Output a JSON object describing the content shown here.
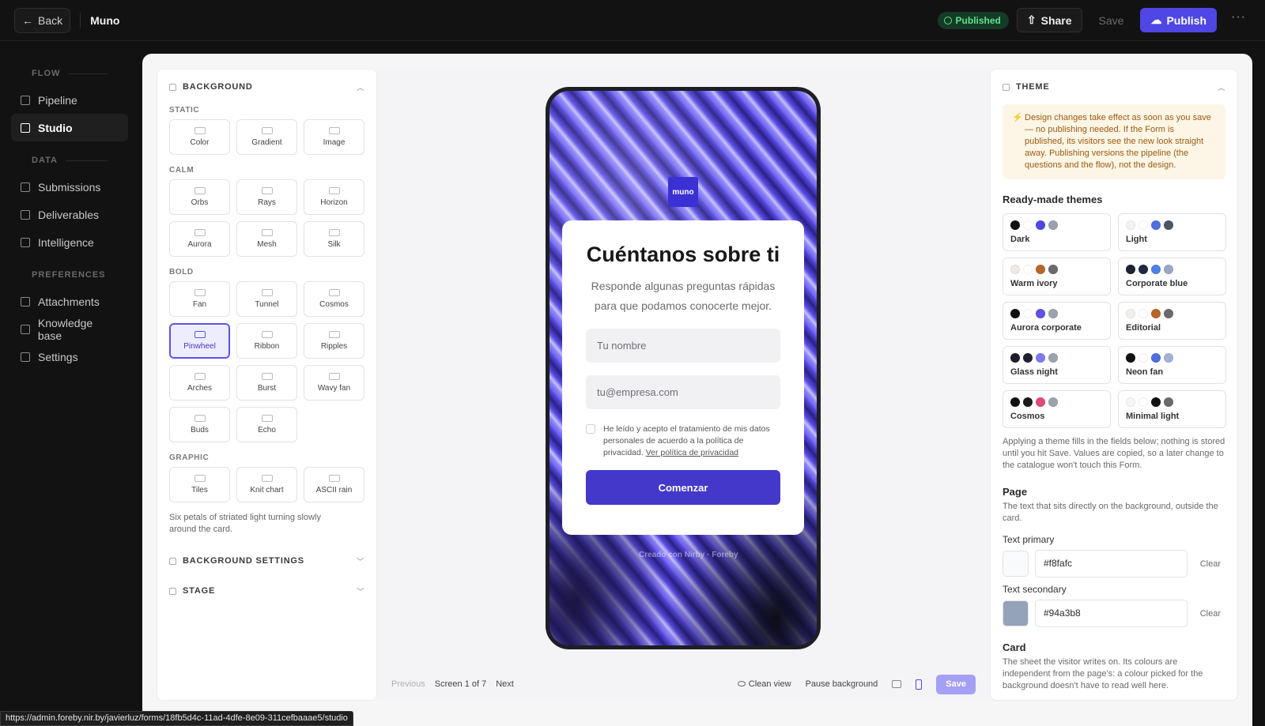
{
  "topbar": {
    "back_label": "Back",
    "title": "Muno",
    "status_badge": "Published",
    "share_label": "Share",
    "save_label": "Save",
    "publish_label": "Publish",
    "more_label": "···"
  },
  "nav": {
    "groups": [
      {
        "label": "FLOW",
        "items": [
          {
            "label": "Pipeline"
          },
          {
            "label": "Studio"
          }
        ]
      },
      {
        "label": "DATA",
        "items": [
          {
            "label": "Submissions"
          },
          {
            "label": "Deliverables"
          },
          {
            "label": "Intelligence"
          }
        ]
      },
      {
        "label": "PREFERENCES",
        "items": [
          {
            "label": "Attachments"
          },
          {
            "label": "Knowledge base"
          },
          {
            "label": "Settings"
          }
        ]
      }
    ],
    "active": "Studio"
  },
  "background_panel": {
    "title": "BACKGROUND",
    "static_label": "STATIC",
    "static": [
      "Color",
      "Gradient",
      "Image"
    ],
    "calm_label": "CALM",
    "calm": [
      "Orbs",
      "Rays",
      "Horizon",
      "Aurora",
      "Mesh",
      "Silk"
    ],
    "bold_label": "BOLD",
    "bold": [
      "Fan",
      "Tunnel",
      "Cosmos",
      "Pinwheel",
      "Ribbon",
      "Ripples",
      "Arches",
      "Burst",
      "Wavy fan",
      "Buds",
      "Echo"
    ],
    "graphic_label": "GRAPHIC",
    "graphic": [
      "Tiles",
      "Knit chart",
      "ASCII rain"
    ],
    "selected": "Pinwheel",
    "description": "Six petals of striated light turning slowly around the card.",
    "settings_label": "BACKGROUND SETTINGS",
    "stage_label": "STAGE"
  },
  "preview": {
    "logo_text": "muno",
    "title": "Cuéntanos sobre ti",
    "lead": "Responde algunas preguntas rápidas para que podamos conocerte mejor.",
    "name_placeholder": "Tu nombre",
    "email_placeholder": "tu@empresa.com",
    "consent_text": "He leído y acepto el tratamiento de mis datos personales de acuerdo a la política de privacidad.",
    "consent_link": "Ver política de privacidad",
    "cta": "Comenzar",
    "powered": "Creado con Nirby · Foreby"
  },
  "canvas_bar": {
    "previous": "Previous",
    "screen_counter": "Screen 1 of 7",
    "next": "Next",
    "clean_view": "Clean view",
    "pause_background": "Pause background",
    "save": "Save"
  },
  "theme_panel": {
    "title": "THEME",
    "note": "Design changes take effect as soon as you save — no publishing needed. If the Form is published, its visitors see the new look straight away. Publishing versions the pipeline (the questions and the flow), not the design.",
    "ready_label": "Ready-made themes",
    "themes": [
      {
        "name": "Dark",
        "colors": [
          "#111111",
          "#ffffff",
          "#4f46e5",
          "#9ca3af"
        ]
      },
      {
        "name": "Light",
        "colors": [
          "#f3f3f3",
          "#ffffff",
          "#4f6fe0",
          "#4b5563"
        ]
      },
      {
        "name": "Warm ivory",
        "colors": [
          "#eeeae2",
          "#ffffff",
          "#b5662a",
          "#6b6b6b"
        ]
      },
      {
        "name": "Corporate blue",
        "colors": [
          "#1c2434",
          "#1e2a45",
          "#4f7fe8",
          "#9aa8c8"
        ]
      },
      {
        "name": "Aurora corporate",
        "colors": [
          "#111111",
          "#ffffff",
          "#5b52e6",
          "#9ca3af"
        ]
      },
      {
        "name": "Editorial",
        "colors": [
          "#f1efe9",
          "#ffffff",
          "#b5662a",
          "#6b6b6b"
        ]
      },
      {
        "name": "Glass night",
        "colors": [
          "#1c1c2e",
          "#202033",
          "#7c7cf0",
          "#9ca3af"
        ]
      },
      {
        "name": "Neon fan",
        "colors": [
          "#111111",
          "#ffffff",
          "#4f6fe0",
          "#a3b1d6"
        ]
      },
      {
        "name": "Cosmos",
        "colors": [
          "#111111",
          "#1a1a1a",
          "#e04a7a",
          "#9ca3af"
        ]
      },
      {
        "name": "Minimal light",
        "colors": [
          "#f6f6f6",
          "#ffffff",
          "#111111",
          "#6b6b6b"
        ]
      }
    ],
    "apply_note": "Applying a theme fills in the fields below; nothing is stored until you hit Save. Values are copied, so a later change to the catalogue won't touch this Form.",
    "page_label": "Page",
    "page_desc": "The text that sits directly on the background, outside the card.",
    "text_primary_label": "Text primary",
    "text_primary_value": "#f8fafc",
    "text_secondary_label": "Text secondary",
    "text_secondary_value": "#94a3b8",
    "clear_label": "Clear",
    "card_label": "Card",
    "card_desc": "The sheet the visitor writes on. Its colours are independent from the page's: a colour picked for the background doesn't have to read well here."
  },
  "status_url": "https://admin.foreby.nir.by/javierluz/forms/18fb5d4c-11ad-4dfe-8e09-311cefbaaae5/studio"
}
